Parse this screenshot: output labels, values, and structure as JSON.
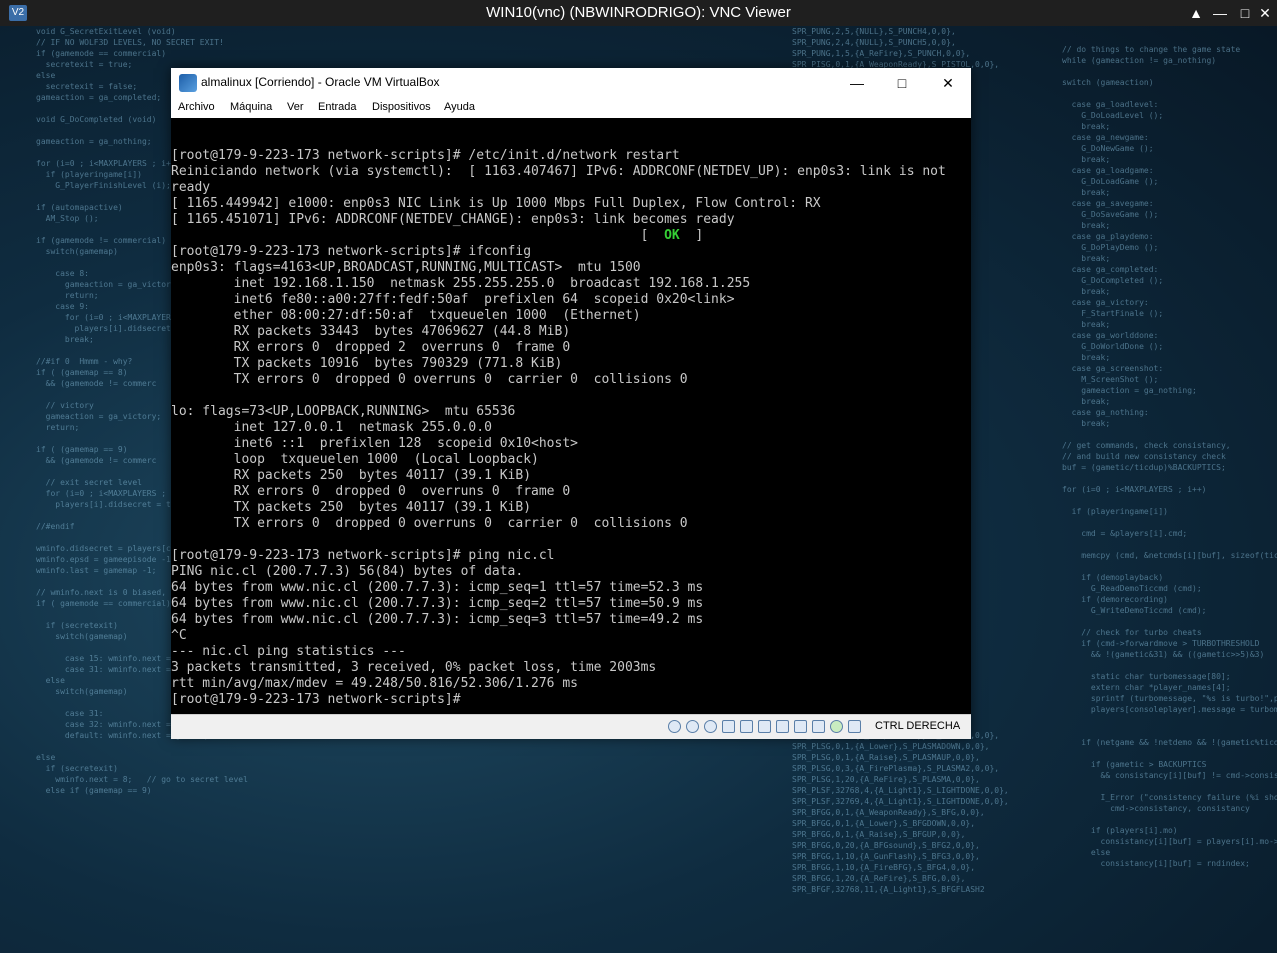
{
  "vnc": {
    "title": "WIN10(vnc) (NBWINRODRIGO): VNC Viewer",
    "logo_text": "V2",
    "icons": [
      "chevron-up-icon",
      "minimize-icon",
      "maximize-icon",
      "close-icon"
    ]
  },
  "vbox": {
    "title": "almalinux [Corriendo] - Oracle VM VirtualBox",
    "menu": [
      "Archivo",
      "Máquina",
      "Ver",
      "Entrada",
      "Dispositivos",
      "Ayuda"
    ],
    "host_key": "CTRL DERECHA"
  },
  "terminal": {
    "lines_before_ok": [
      "[root@179-9-223-173 network-scripts]# /etc/init.d/network restart",
      "Reiniciando network (via systemctl):  [ 1163.407467] IPv6: ADDRCONF(NETDEV_UP): enp0s3: link is not",
      "ready",
      "[ 1165.449942] e1000: enp0s3 NIC Link is Up 1000 Mbps Full Duplex, Flow Control: RX",
      "[ 1165.451071] IPv6: ADDRCONF(NETDEV_CHANGE): enp0s3: link becomes ready"
    ],
    "ok_prefix": "                                                            [  ",
    "ok_text": "OK",
    "ok_suffix": "  ]",
    "lines_after_ok": [
      "[root@179-9-223-173 network-scripts]# ifconfig",
      "enp0s3: flags=4163<UP,BROADCAST,RUNNING,MULTICAST>  mtu 1500",
      "        inet 192.168.1.150  netmask 255.255.255.0  broadcast 192.168.1.255",
      "        inet6 fe80::a00:27ff:fedf:50af  prefixlen 64  scopeid 0x20<link>",
      "        ether 08:00:27:df:50:af  txqueuelen 1000  (Ethernet)",
      "        RX packets 33443  bytes 47069627 (44.8 MiB)",
      "        RX errors 0  dropped 2  overruns 0  frame 0",
      "        TX packets 10916  bytes 790329 (771.8 KiB)",
      "        TX errors 0  dropped 0 overruns 0  carrier 0  collisions 0",
      "",
      "lo: flags=73<UP,LOOPBACK,RUNNING>  mtu 65536",
      "        inet 127.0.0.1  netmask 255.0.0.0",
      "        inet6 ::1  prefixlen 128  scopeid 0x10<host>",
      "        loop  txqueuelen 1000  (Local Loopback)",
      "        RX packets 250  bytes 40117 (39.1 KiB)",
      "        RX errors 0  dropped 0  overruns 0  frame 0",
      "        TX packets 250  bytes 40117 (39.1 KiB)",
      "        TX errors 0  dropped 0 overruns 0  carrier 0  collisions 0",
      "",
      "[root@179-9-223-173 network-scripts]# ping nic.cl",
      "PING nic.cl (200.7.7.3) 56(84) bytes of data.",
      "64 bytes from www.nic.cl (200.7.7.3): icmp_seq=1 ttl=57 time=52.3 ms",
      "64 bytes from www.nic.cl (200.7.7.3): icmp_seq=2 ttl=57 time=50.9 ms",
      "64 bytes from www.nic.cl (200.7.7.3): icmp_seq=3 ttl=57 time=49.2 ms",
      "^C",
      "--- nic.cl ping statistics ---",
      "3 packets transmitted, 3 received, 0% packet loss, time 2003ms",
      "rtt min/avg/max/mdev = 49.248/50.816/52.306/1.276 ms",
      "[root@179-9-223-173 network-scripts]# "
    ]
  },
  "desktop_code": {
    "left": [
      "void G_SecretExitLevel (void)",
      "// IF NO WOLF3D LEVELS, NO SECRET EXIT!",
      "if (gamemode == commercial)",
      "  secretexit = true;",
      "else",
      "  secretexit = false;",
      "gameaction = ga_completed;",
      "",
      "void G_DoCompleted (void)",
      "",
      "gameaction = ga_nothing;",
      "",
      "for (i=0 ; i<MAXPLAYERS ; i++)",
      "  if (playeringame[i])",
      "    G_PlayerFinishLevel (i);",
      "",
      "if (automapactive)",
      "  AM_Stop ();",
      "",
      "if (gamemode != commercial)",
      "  switch(gamemap)",
      "",
      "    case 8:",
      "      gameaction = ga_victory;",
      "      return;",
      "    case 9:",
      "      for (i=0 ; i<MAXPLAYERS",
      "        players[i].didsecret",
      "      break;",
      "",
      "//#if 0  Hmmm - why?",
      "if ( (gamemap == 8)",
      "  && (gamemode != commerc",
      "",
      "  // victory",
      "  gameaction = ga_victory;",
      "  return;",
      "",
      "if ( (gamemap == 9)",
      "  && (gamemode != commerc",
      "",
      "  // exit secret level",
      "  for (i=0 ; i<MAXPLAYERS ;",
      "    players[i].didsecret = true;",
      "",
      "//#endif",
      "",
      "wminfo.didsecret = players[consolepl",
      "wminfo.epsd = gameepisode -1;",
      "wminfo.last = gamemap -1;",
      "",
      "// wminfo.next is 0 biased, unlike ga",
      "if ( gamemode == commercial)",
      "",
      "  if (secretexit)",
      "    switch(gamemap)",
      "",
      "      case 15: wminfo.next = 30; break;",
      "      case 31: wminfo.next = 31; break;",
      "  else",
      "    switch(gamemap)",
      "",
      "      case 31:",
      "      case 32: wminfo.next = 15; break;",
      "      default: wminfo.next = gamemap;",
      "",
      "else",
      "  if (secretexit)",
      "    wminfo.next = 8;   // go to secret level",
      "  else if (gamemap == 9)"
    ],
    "right": [
      "// do things to change the game state",
      "while (gameaction != ga_nothing)",
      "",
      "switch (gameaction)",
      "",
      "  case ga_loadlevel:",
      "    G_DoLoadLevel ();",
      "    break;",
      "  case ga_newgame:",
      "    G_DoNewGame ();",
      "    break;",
      "  case ga_loadgame:",
      "    G_DoLoadGame ();",
      "    break;",
      "  case ga_savegame:",
      "    G_DoSaveGame ();",
      "    break;",
      "  case ga_playdemo:",
      "    G_DoPlayDemo ();",
      "    break;",
      "  case ga_completed:",
      "    G_DoCompleted ();",
      "    break;",
      "  case ga_victory:",
      "    F_StartFinale ();",
      "    break;",
      "  case ga_worlddone:",
      "    G_DoWorldDone ();",
      "    break;",
      "  case ga_screenshot:",
      "    M_ScreenShot ();",
      "    gameaction = ga_nothing;",
      "    break;",
      "  case ga_nothing:",
      "    break;",
      "",
      "// get commands, check consistancy,",
      "// and build new consistancy check",
      "buf = (gametic/ticdup)%BACKUPTICS;",
      "",
      "for (i=0 ; i<MAXPLAYERS ; i++)",
      "",
      "  if (playeringame[i])",
      "",
      "    cmd = &players[i].cmd;",
      "",
      "    memcpy (cmd, &netcmds[i][buf], sizeof(ticcmd_t));",
      "",
      "    if (demoplayback)",
      "      G_ReadDemoTiccmd (cmd);",
      "    if (demorecording)",
      "      G_WriteDemoTiccmd (cmd);",
      "",
      "    // check for turbo cheats",
      "    if (cmd->forwardmove > TURBOTHRESHOLD",
      "      && !(gametic&31) && ((gametic>>5)&3)",
      "",
      "      static char turbomessage[80];",
      "      extern char *player_names[4];",
      "      sprintf (turbomessage, \"%s is turbo!\",player",
      "      players[consoleplayer].message = turbom",
      "",
      "",
      "    if (netgame && !netdemo && !(gametic%ticdup)",
      "",
      "      if (gametic > BACKUPTICS",
      "        && consistancy[i][buf] != cmd->consist",
      "",
      "        I_Error (\"consistency failure (%i should",
      "          cmd->consistancy, consistancy",
      "",
      "      if (players[i].mo)",
      "        consistancy[i][buf] = players[i].mo->x;",
      "      else",
      "        consistancy[i][buf] = rndindex;"
    ],
    "middle": [
      "SPR_PUNG,2,5,{NULL},S_PUNCH4,0,0},",
      "SPR_PUNG,2,4,{NULL},S_PUNCH5,0,0},",
      "SPR_PUNG,1,5,{A_ReFire},S_PUNCH,0,0},",
      "SPR_PISG,0,1,{A_WeaponReady},S_PISTOL,0,0},",
      "",
      "",
      "",
      "",
      "",
      "",
      "",
      "",
      "",
      "",
      "",
      "",
      "",
      "",
      "",
      "",
      "",
      "",
      "",
      "",
      "",
      "",
      "",
      "",
      "",
      "",
      "",
      "",
      "",
      "",
      "",
      "",
      "",
      "",
      "",
      "",
      "",
      "",
      "",
      "",
      "",
      "",
      "",
      "",
      "",
      "",
      "",
      "",
      "",
      "",
      "",
      "",
      "",
      "",
      "",
      "",
      "SPR_SAWG,2,4,{A_Raise},S_SAWUP,0,0},",
      "SPR_SAWG,0,4,{A_Saw},S_SAW2,0,0},",
      "SPR_SAWG,1,4,{A_Saw},S_SAW3,0,0},",
      "SPR_SAWG,1,4,{A_ReFire},S_SAW,0,0},",
      "SPR_PLSG,0,1,{A_WeaponReady},S_PLASMA,0,0},",
      "SPR_PLSG,0,1,{A_Lower},S_PLASMADOWN,0,0},",
      "SPR_PLSG,0,1,{A_Raise},S_PLASMAUP,0,0},",
      "SPR_PLSG,0,3,{A_FirePlasma},S_PLASMA2,0,0},",
      "SPR_PLSG,1,20,{A_ReFire},S_PLASMA,0,0},",
      "SPR_PLSF,32768,4,{A_Light1},S_LIGHTDONE,0,0},",
      "SPR_PLSF,32769,4,{A_Light1},S_LIGHTDONE,0,0},",
      "SPR_BFGG,0,1,{A_WeaponReady},S_BFG,0,0},",
      "SPR_BFGG,0,1,{A_Lower},S_BFGDOWN,0,0},",
      "SPR_BFGG,0,1,{A_Raise},S_BFGUP,0,0},",
      "SPR_BFGG,0,20,{A_BFGsound},S_BFG2,0,0},",
      "SPR_BFGG,1,10,{A_GunFlash},S_BFG3,0,0},",
      "SPR_BFGG,1,10,{A_FireBFG},S_BFG4,0,0},",
      "SPR_BFGG,1,20,{A_ReFire},S_BFG,0,0},",
      "SPR_BFGF,32768,11,{A_Light1},S_BFGFLASH2"
    ]
  }
}
